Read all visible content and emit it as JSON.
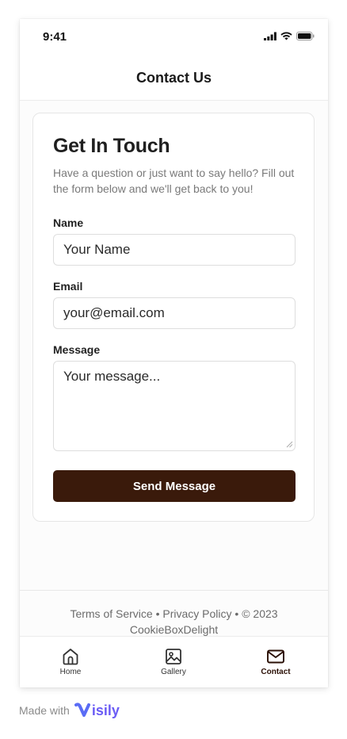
{
  "status_bar": {
    "time": "9:41"
  },
  "header": {
    "title": "Contact Us"
  },
  "form": {
    "title": "Get In Touch",
    "description": "Have a question or just want to say hello? Fill out the form below and we'll get back to you!",
    "name_label": "Name",
    "name_placeholder": "Your Name",
    "email_label": "Email",
    "email_placeholder": "your@email.com",
    "message_label": "Message",
    "message_placeholder": "Your message...",
    "submit_label": "Send Message"
  },
  "footer": {
    "terms": "Terms of Service",
    "separator1": " • ",
    "privacy": "Privacy Policy",
    "separator2": " • ",
    "copyright": "© 2023",
    "brand": "CookieBoxDelight"
  },
  "bottom_nav": {
    "items": [
      {
        "label": "Home",
        "icon": "home-icon",
        "active": false
      },
      {
        "label": "Gallery",
        "icon": "image-icon",
        "active": false
      },
      {
        "label": "Contact",
        "icon": "mail-icon",
        "active": true
      }
    ]
  },
  "branding": {
    "made_with": "Made with",
    "logo_text": "isily"
  },
  "colors": {
    "primary_button": "#3a1a0b",
    "accent_logo": "#6b5cf5"
  }
}
